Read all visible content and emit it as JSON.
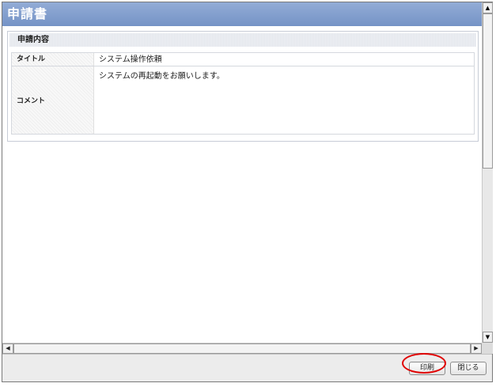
{
  "window": {
    "title": "申請書"
  },
  "panel": {
    "header": "申請内容",
    "fields": [
      {
        "label": "タイトル",
        "value": "システム操作依頼"
      },
      {
        "label": "コメント",
        "value": "システムの再起動をお願いします。"
      }
    ]
  },
  "scrollbars": {
    "up_icon": "▲",
    "down_icon": "▼",
    "left_icon": "◀",
    "right_icon": "▶"
  },
  "footer": {
    "print_label": "印刷",
    "close_label": "閉じる"
  },
  "colors": {
    "title_bar": "#7f9bcc",
    "highlight": "#e00000"
  }
}
